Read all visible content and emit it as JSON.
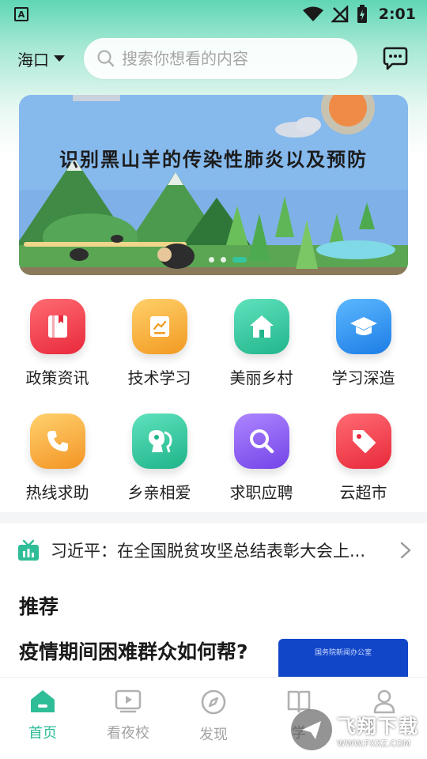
{
  "status_bar": {
    "app_letter": "A",
    "time": "2:01"
  },
  "header": {
    "city": "海口",
    "search_placeholder": "搜索你想看的内容"
  },
  "banner": {
    "title": "识别黑山羊的传染性肺炎以及预防",
    "slide_count": 3,
    "active_slide": 3
  },
  "grid": [
    {
      "label": "政策资讯",
      "icon": "book-icon",
      "color": "#f0394a"
    },
    {
      "label": "技术学习",
      "icon": "chart-book-icon",
      "color": "#f6a531"
    },
    {
      "label": "美丽乡村",
      "icon": "home-icon",
      "color": "#2fc79d"
    },
    {
      "label": "学习深造",
      "icon": "graduation-cap-icon",
      "color": "#2b8ff0"
    },
    {
      "label": "热线求助",
      "icon": "phone-icon",
      "color": "#f8a430"
    },
    {
      "label": "乡亲相爱",
      "icon": "people-icon",
      "color": "#2ec59c"
    },
    {
      "label": "求职应聘",
      "icon": "search-icon",
      "color": "#8a5cf0"
    },
    {
      "label": "云超市",
      "icon": "tag-icon",
      "color": "#f03a4a"
    }
  ],
  "ticker": {
    "text": "习近平：在全国脱贫攻坚总结表彰大会上..."
  },
  "recommend": {
    "title": "推荐",
    "article_title": "疫情期间困难群众如何帮?",
    "thumb_text": "国务院新闻办公室"
  },
  "bottom_nav": [
    {
      "label": "首页",
      "icon": "home-icon",
      "active": true
    },
    {
      "label": "看夜校",
      "icon": "video-icon",
      "active": false
    },
    {
      "label": "发现",
      "icon": "compass-icon",
      "active": false
    },
    {
      "label": "学",
      "icon": "book-icon",
      "active": false
    },
    {
      "label": "",
      "icon": "user-icon",
      "active": false
    }
  ],
  "watermark": {
    "brand": "飞翔下载",
    "url": "WWW.FXXZ.COM"
  },
  "colors": {
    "accent": "#2fbd97",
    "inactive": "#a3a3a3"
  }
}
